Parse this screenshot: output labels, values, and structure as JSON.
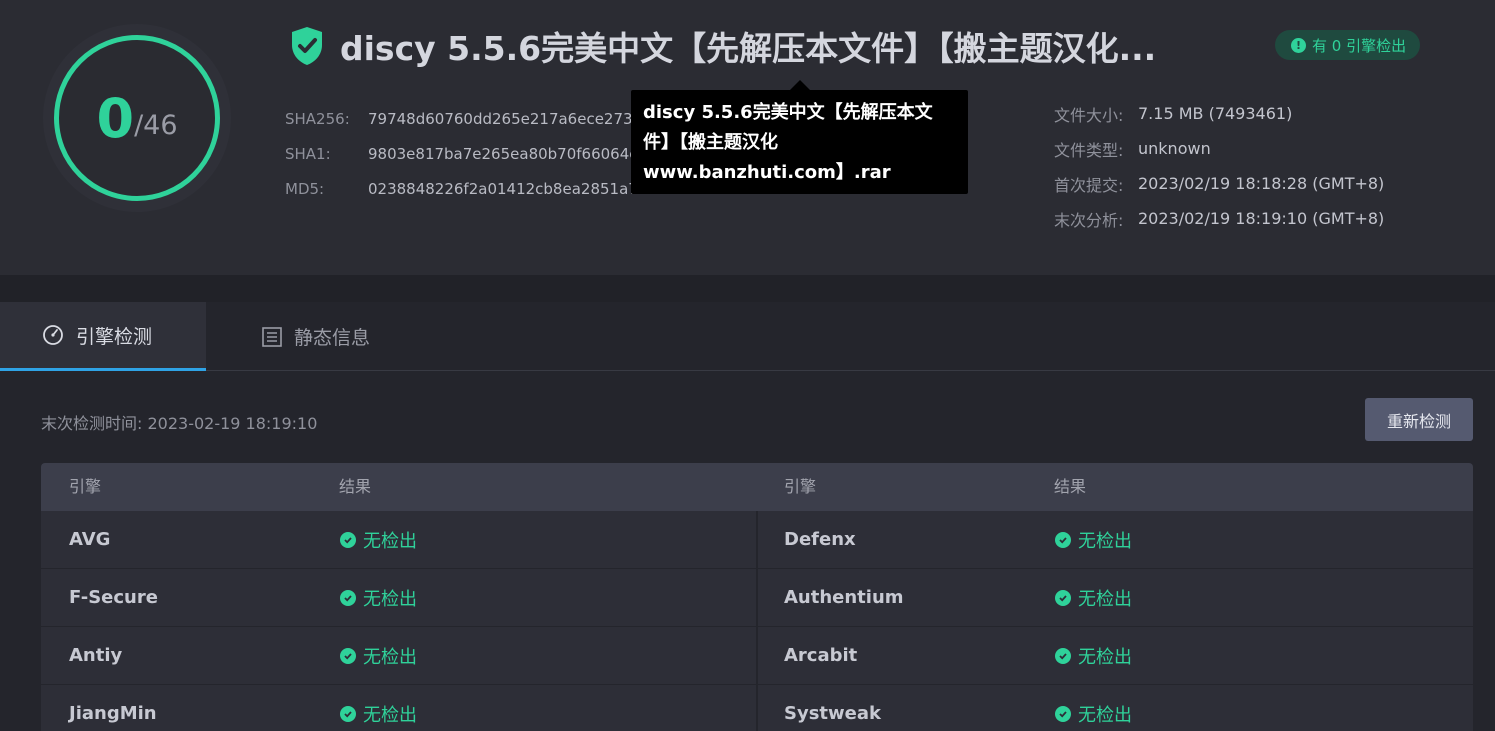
{
  "score": {
    "detected": "0",
    "total": "/46"
  },
  "file": {
    "title": "discy 5.5.6完美中文【先解压本文件】【搬主题汉化...",
    "tooltip_lines": [
      "discy 5.5.6完美中文【先解压本文",
      "件】【搬主题汉化",
      "www.banzhuti.com】.rar"
    ]
  },
  "badge": {
    "label": "有 0 引擎检出",
    "icon": "exclamation-icon"
  },
  "hashes": [
    {
      "label": "SHA256:",
      "value": "79748d60760dd265e217a6ece273e...19767"
    },
    {
      "label": "SHA1:",
      "value": "9803e817ba7e265ea80b70f66064e0...4"
    },
    {
      "label": "MD5:",
      "value": "0238848226f2a01412cb8ea2851a7348"
    }
  ],
  "meta": [
    {
      "label": "文件大小:",
      "value": "7.15 MB (7493461)"
    },
    {
      "label": "文件类型:",
      "value": "unknown"
    },
    {
      "label": "首次提交:",
      "value": "2023/02/19 18:18:28 (GMT+8)"
    },
    {
      "label": "末次分析:",
      "value": "2023/02/19 18:19:10 (GMT+8)"
    }
  ],
  "tabs": {
    "engine": "引擎检测",
    "static": "静态信息"
  },
  "last_check": "末次检测时间: 2023-02-19 18:19:10",
  "recheck_label": "重新检测",
  "table": {
    "headers": [
      "引擎",
      "结果",
      "引擎",
      "结果"
    ],
    "rows": [
      {
        "left_engine": "AVG",
        "left_result": "无检出",
        "right_engine": "Defenx",
        "right_result": "无检出"
      },
      {
        "left_engine": "F-Secure",
        "left_result": "无检出",
        "right_engine": "Authentium",
        "right_result": "无检出"
      },
      {
        "left_engine": "Antiy",
        "left_result": "无检出",
        "right_engine": "Arcabit",
        "right_result": "无检出"
      },
      {
        "left_engine": "JiangMin",
        "left_result": "无检出",
        "right_engine": "Systweak",
        "right_result": "无检出"
      }
    ]
  },
  "colors": {
    "accent_green": "#2fd29a",
    "tab_underline": "#2fa3e6"
  }
}
